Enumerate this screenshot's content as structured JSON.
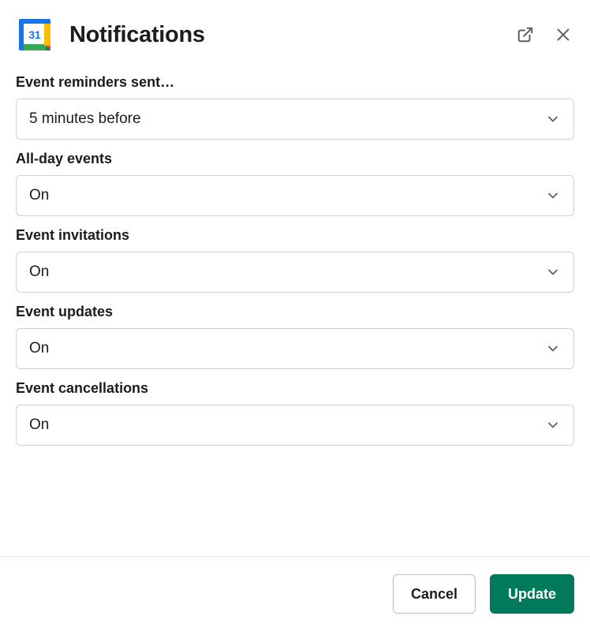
{
  "header": {
    "title": "Notifications",
    "icon_date": "31"
  },
  "fields": {
    "reminders": {
      "label": "Event reminders sent…",
      "value": "5 minutes before"
    },
    "allday": {
      "label": "All-day events",
      "value": "On"
    },
    "invitations": {
      "label": "Event invitations",
      "value": "On"
    },
    "updates": {
      "label": "Event updates",
      "value": "On"
    },
    "cancellations": {
      "label": "Event cancellations",
      "value": "On"
    }
  },
  "footer": {
    "cancel": "Cancel",
    "update": "Update"
  }
}
